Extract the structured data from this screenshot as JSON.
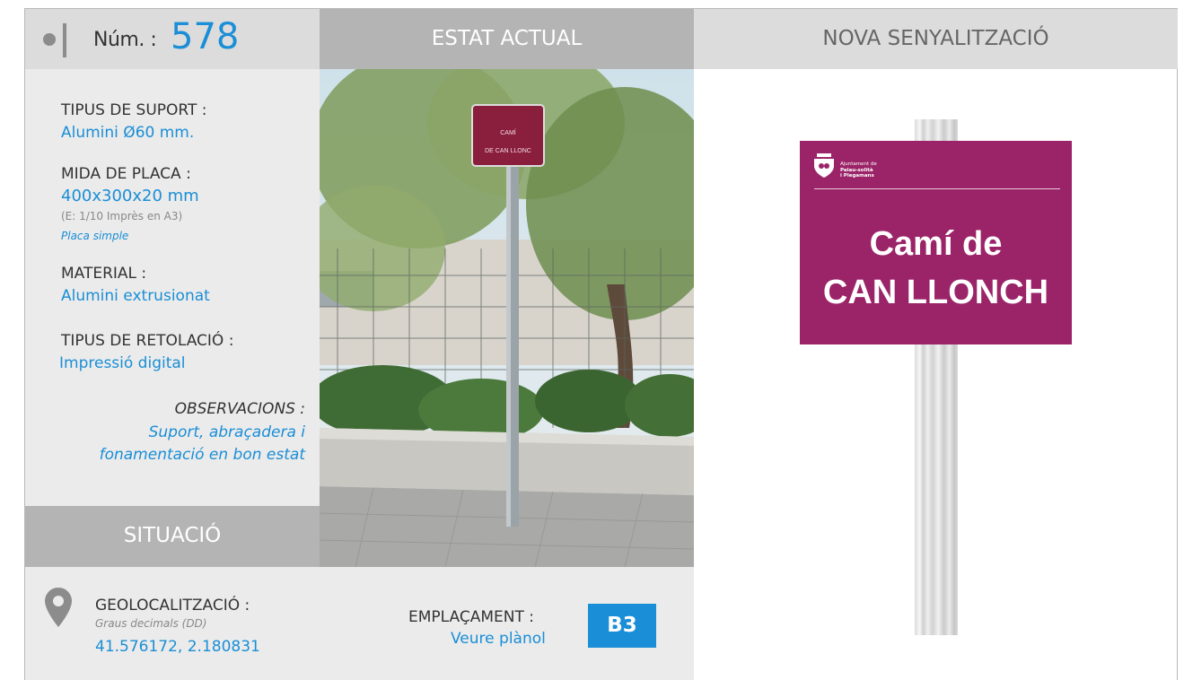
{
  "header": {
    "num_label": "Núm. :",
    "num_value": "578",
    "estat_title": "ESTAT ACTUAL",
    "nova_title": "NOVA SENYALITZACIÓ"
  },
  "specs": {
    "suport_label": "TIPUS DE SUPORT :",
    "suport_value": "Alumini Ø60 mm.",
    "mida_label": "MIDA DE PLACA :",
    "mida_value": "400x300x20 mm",
    "mida_note": "(E: 1/10 Imprès en A3)",
    "mida_type": "Placa simple",
    "material_label": "MATERIAL :",
    "material_value": "Alumini extrusionat",
    "retolacio_label": "TIPUS DE RETOLACIÓ :",
    "retolacio_value": "Impressió digital",
    "obs_label": "OBSERVACIONS :",
    "obs_line1": "Suport, abraçadera i",
    "obs_line2": "fonamentació en bon estat"
  },
  "situacio": {
    "title": "SITUACIÓ",
    "geo_label": "GEOLOCALITZACIÓ :",
    "geo_format": "Graus decimals (DD)",
    "geo_value": "41.576172, 2.180831",
    "empl_label": "EMPLAÇAMENT :",
    "empl_value": "Veure plànol",
    "empl_code": "B3",
    "pin_icon": "map-pin-icon"
  },
  "photo": {
    "sign_line1": "CAMÍ",
    "sign_line2": "DE CAN LLONC"
  },
  "new_sign": {
    "logo_line1": "Ajuntament de",
    "logo_line2": "Palau-solità",
    "logo_line3": "i Plegamans",
    "line1": "Camí de",
    "line2": "CAN LLONCH",
    "color": "#9b2469"
  },
  "colors": {
    "accent": "#1a8ed6",
    "header_dark": "#b4b4b4",
    "header_light": "#dcdcdc",
    "panel": "#ebebeb"
  }
}
